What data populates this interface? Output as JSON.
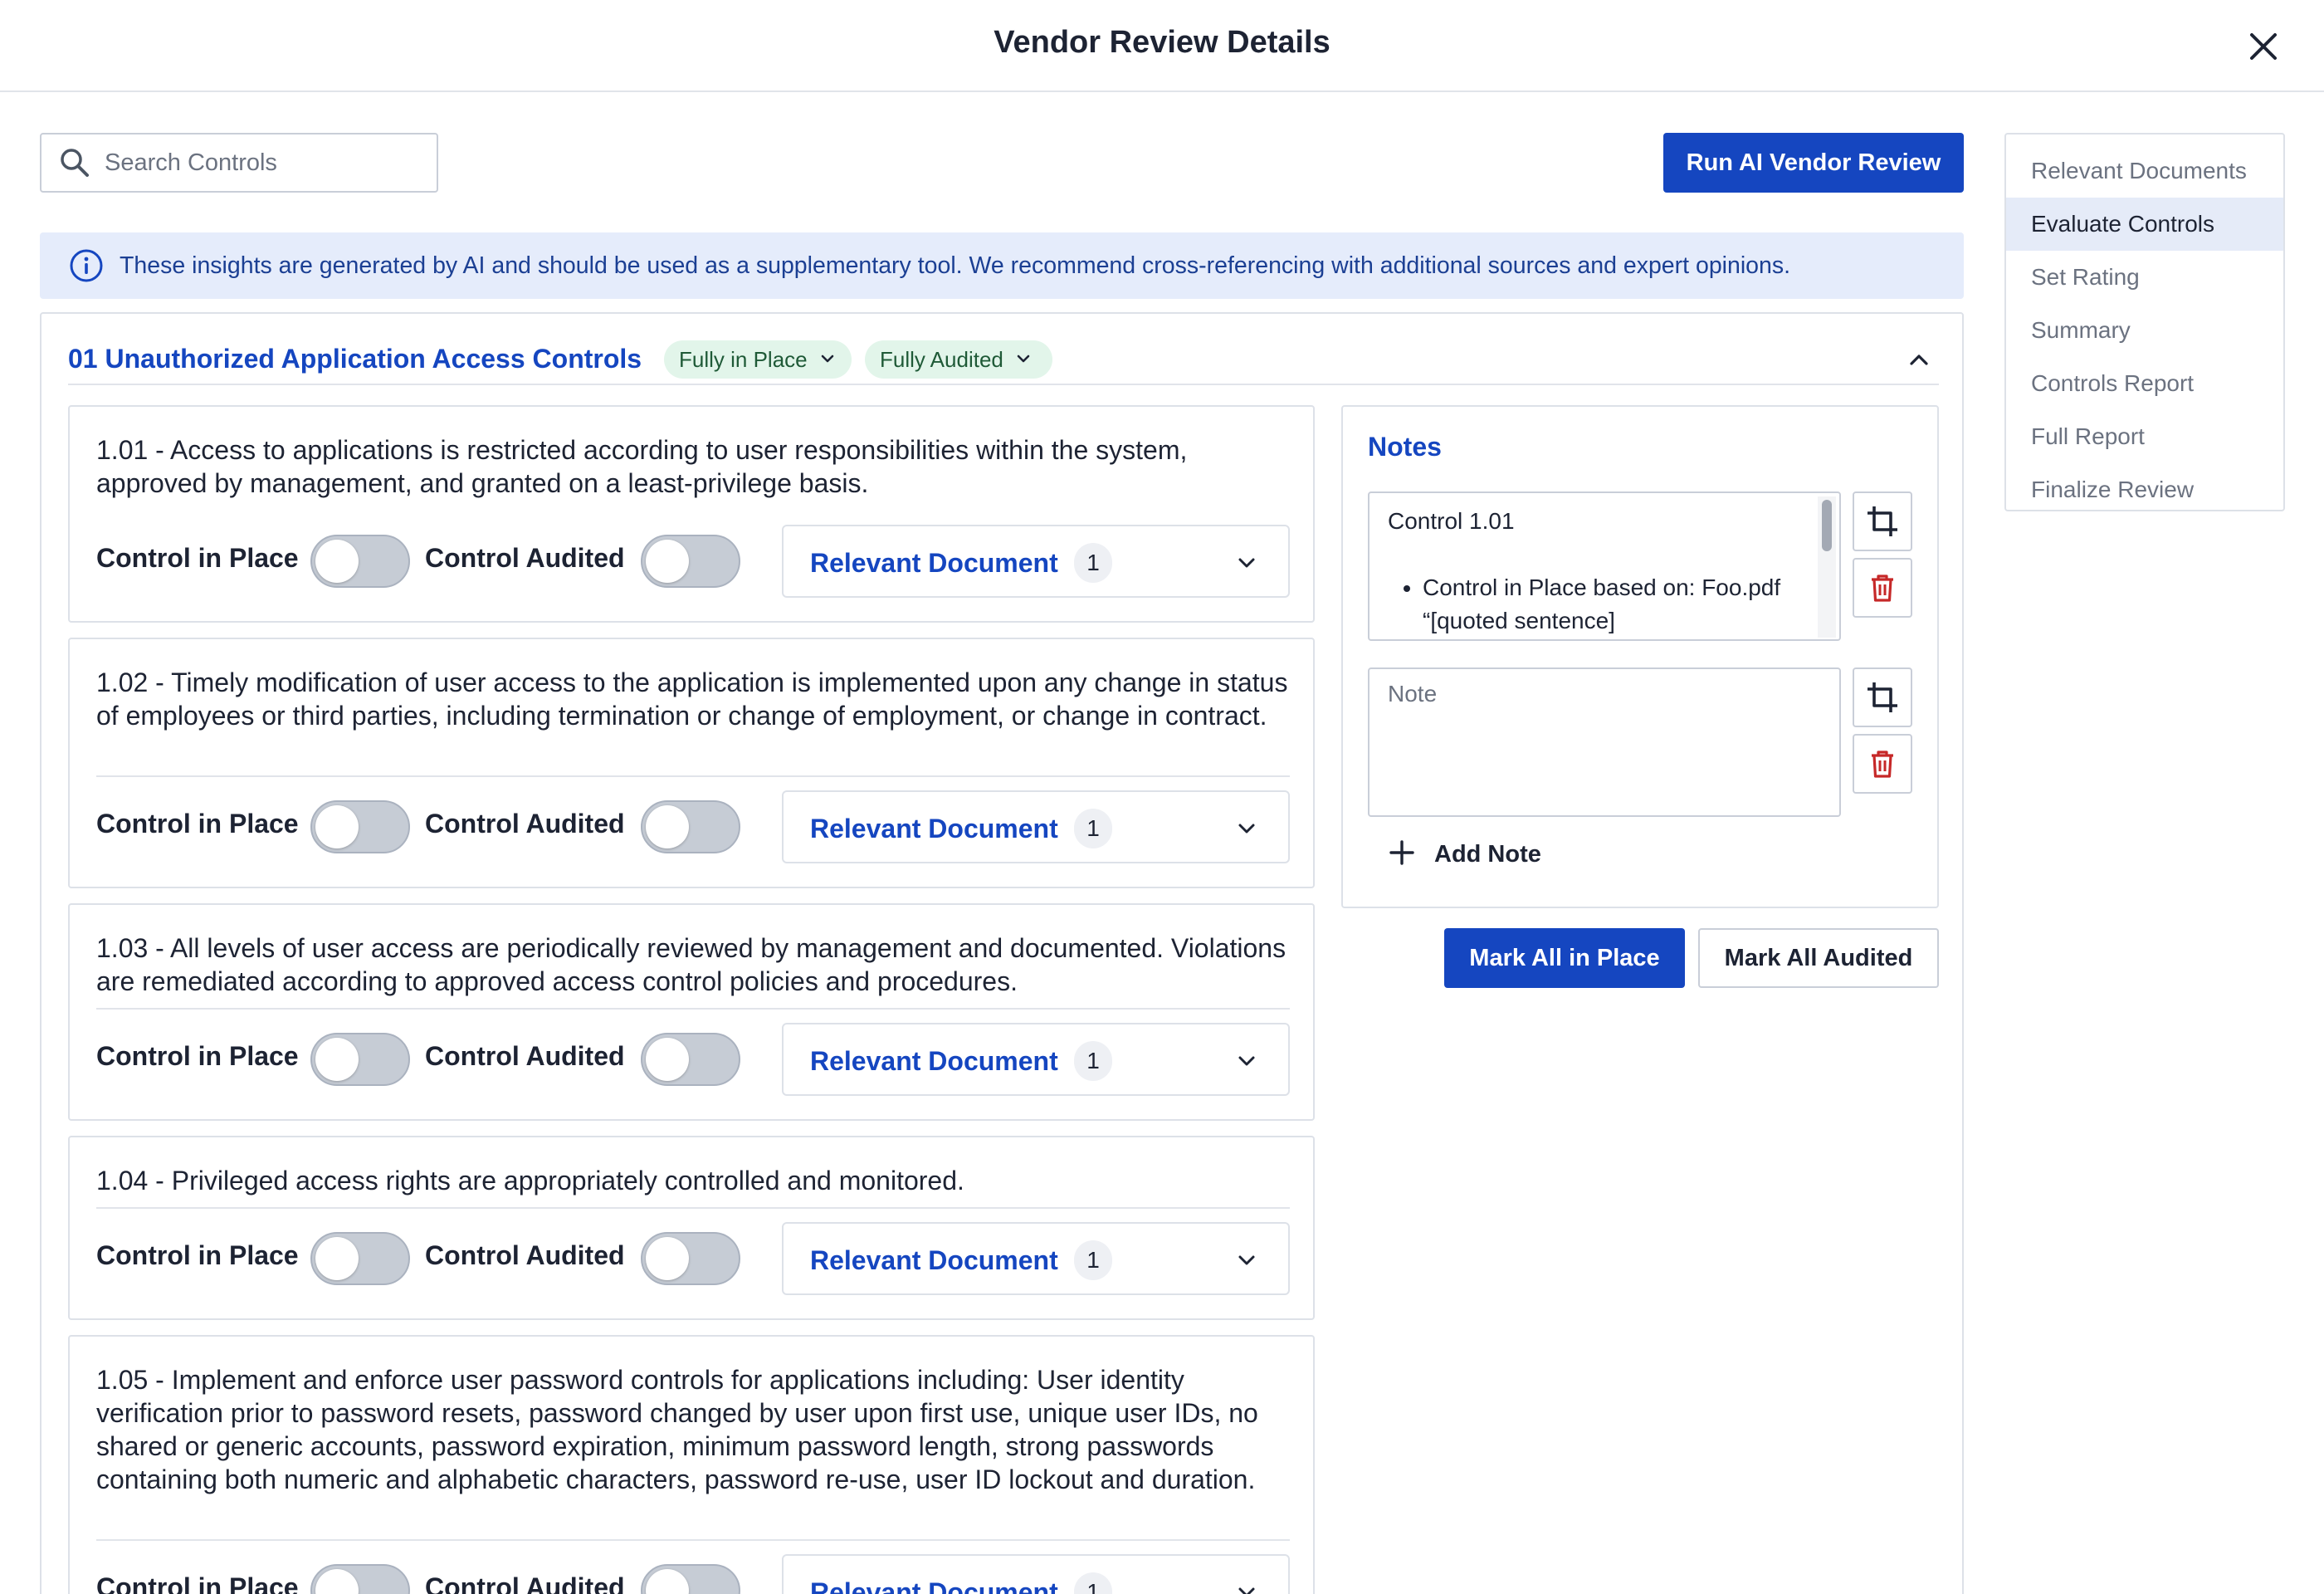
{
  "header": {
    "title": "Vendor Review Details"
  },
  "search": {
    "placeholder": "Search Controls"
  },
  "actions": {
    "run_ai": "Run AI Vendor Review",
    "mark_all_in_place": "Mark All in Place",
    "mark_all_audited": "Mark All Audited"
  },
  "sidenav": {
    "items": [
      {
        "label": "Relevant Documents",
        "active": false
      },
      {
        "label": "Evaluate Controls",
        "active": true
      },
      {
        "label": "Set Rating",
        "active": false
      },
      {
        "label": "Summary",
        "active": false
      },
      {
        "label": "Controls Report",
        "active": false
      },
      {
        "label": "Full Report",
        "active": false
      },
      {
        "label": "Finalize Review",
        "active": false
      }
    ]
  },
  "banner": {
    "text": "These insights are generated by AI and should be used as a supplementary tool. We recommend cross-referencing with additional sources and expert opinions."
  },
  "section": {
    "title": "01 Unauthorized Application Access Controls",
    "status_in_place": "Fully in Place",
    "status_audited": "Fully Audited"
  },
  "labels": {
    "control_in_place": "Control in Place",
    "control_audited": "Control Audited",
    "relevant_document": "Relevant Document"
  },
  "controls": [
    {
      "text": "1.01 - Access to applications is restricted according to user responsibilities within the system, approved by management, and granted on a least-privilege basis.",
      "in_place": false,
      "audited": false,
      "doc_count": "1"
    },
    {
      "text": "1.02 - Timely modification of user access to the application is implemented upon any change in status of employees or third parties, including termination or change of employment, or change in contract.",
      "in_place": false,
      "audited": false,
      "doc_count": "1"
    },
    {
      "text": "1.03 - All levels of user access are periodically reviewed by management and documented. Violations are remediated according to approved access control policies and procedures.",
      "in_place": false,
      "audited": false,
      "doc_count": "1"
    },
    {
      "text": "1.04 - Privileged access rights are appropriately controlled and monitored.",
      "in_place": false,
      "audited": false,
      "doc_count": "1"
    },
    {
      "text": "1.05 - Implement and enforce user password controls for applications including: User identity verification prior to password resets, password changed by user upon first use, unique user IDs, no shared or generic accounts, password expiration, minimum password length, strong passwords containing both numeric and alphabetic characters, password re-use, user ID lockout and duration.",
      "in_place": false,
      "audited": false,
      "doc_count": "1"
    }
  ],
  "notes": {
    "title": "Notes",
    "note1_heading": "Control 1.01",
    "note1_bullet": "Control in Place based on: Foo.pdf “[quoted sentence]",
    "note2_placeholder": "Note",
    "add_note": "Add Note"
  },
  "colors": {
    "primary": "#1546c0",
    "danger": "#c62828",
    "badge_bg": "#e2f5ea",
    "banner_bg": "#e5ecfb"
  }
}
